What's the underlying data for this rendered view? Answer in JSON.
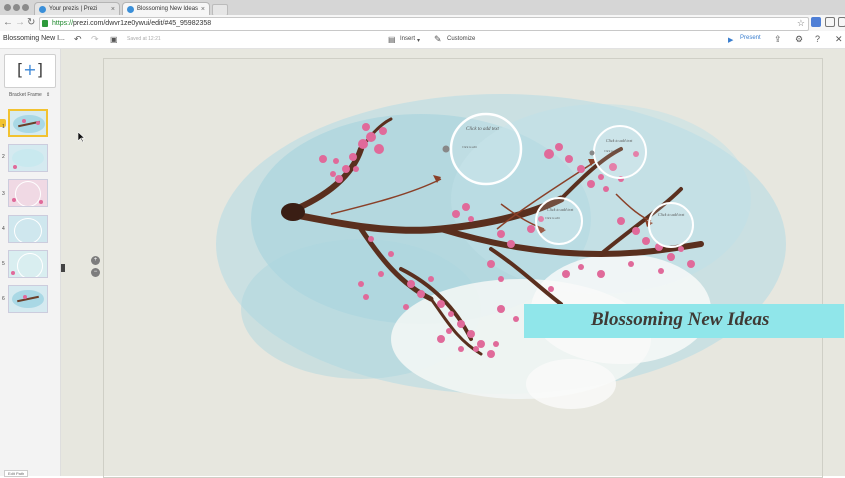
{
  "browser": {
    "tabs": [
      {
        "label": "Your prezis | Prezi",
        "active": false
      },
      {
        "label": "Blossoming New Ideas",
        "active": true
      }
    ],
    "url_scheme": "https://",
    "url_rest": "prezi.com/dwvr1ze0ywui/edit/#45_95982358"
  },
  "toolbar": {
    "title": "Blossoming New I...",
    "saved": "Saved at 12:21",
    "insert_label": "Insert",
    "customize_label": "Customize",
    "present_label": "Present"
  },
  "sidebar": {
    "frame_label": "Bracket Frame",
    "frame_glyph": "[ + ]",
    "thumbnails": [
      {
        "num": "1"
      },
      {
        "num": "2"
      },
      {
        "num": "3"
      },
      {
        "num": "4"
      },
      {
        "num": "5"
      },
      {
        "num": "6"
      }
    ],
    "edit_path_label": "Edit Path"
  },
  "canvas": {
    "title": "Blossoming New Ideas",
    "circles": [
      {
        "title": "Click to add text",
        "body": "Click to edit"
      },
      {
        "title": "Click to add text",
        "body": "Click to edit"
      },
      {
        "title": "Click to add text",
        "body": "Click to edit"
      },
      {
        "title": "Click to add text",
        "body": ""
      }
    ],
    "zoom_in": "+",
    "zoom_out": "−"
  },
  "colors": {
    "accent": "#3a7ecf",
    "title_band": "#90e6ea",
    "blossom": "#e06a9a",
    "branch": "#5a2f1e",
    "watercolor": "#a9d8e5"
  }
}
